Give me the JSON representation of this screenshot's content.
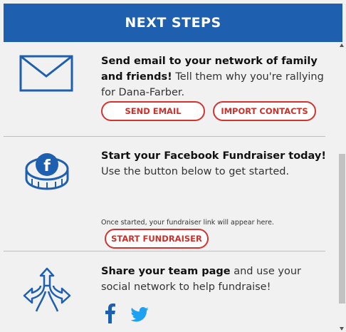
{
  "header": {
    "title": "NEXT STEPS"
  },
  "email_section": {
    "bold": "Send email to your network of family and friends!",
    "rest": " Tell them why you're rallying for Dana-Farber.",
    "send_button": "SEND EMAIL",
    "import_button": "IMPORT CONTACTS"
  },
  "facebook_section": {
    "bold": "Start your Facebook Fundraiser today!",
    "rest": " Use the button below to get started.",
    "start_button": "START FUNDRAISER",
    "note": "Once started, your fundraiser link will appear here."
  },
  "share_section": {
    "bold": "Share your team page",
    "rest": " and use your social network to help fundraise!"
  },
  "colors": {
    "header_bg": "#1f5fb0",
    "accent_red": "#d4342f",
    "icon_blue": "#1f5fb0"
  },
  "icons": [
    "envelope-icon",
    "facebook-coin-icon",
    "split-arrows-icon",
    "facebook-icon",
    "twitter-icon"
  ]
}
